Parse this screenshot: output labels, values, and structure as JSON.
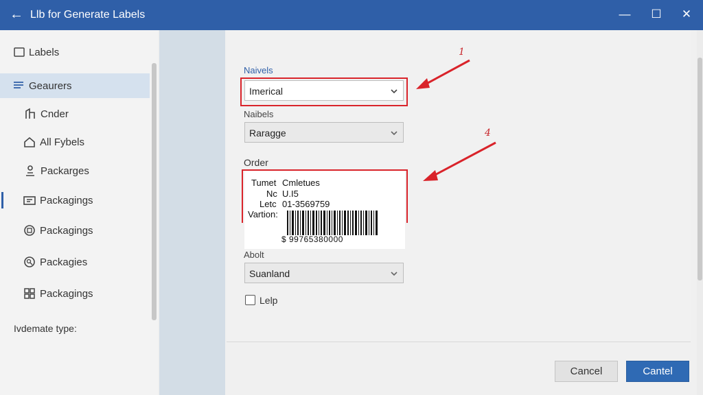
{
  "window": {
    "title": "Llb for Generate Labels",
    "back_icon": "arrow-left-icon",
    "minimize_glyph": "—",
    "maximize_glyph": "☐",
    "close_glyph": "✕"
  },
  "sidebar": {
    "header": "Labels",
    "items": [
      {
        "label": "Geaurers",
        "icon": "list-icon",
        "active": true
      },
      {
        "label": "Cnder",
        "icon": "building-icon"
      },
      {
        "label": "All Fybels",
        "icon": "house-icon"
      },
      {
        "label": "Packarges",
        "icon": "person-icon"
      },
      {
        "label": "Packagings",
        "icon": "folder-icon"
      },
      {
        "label": "Packagings",
        "icon": "package-icon"
      },
      {
        "label": "Packagies",
        "icon": "search-circle-icon"
      },
      {
        "label": "Packagings",
        "icon": "grid-icon"
      }
    ],
    "footer": "Ivdemate type:"
  },
  "form": {
    "field1": {
      "label": "Naivels",
      "value": "Imerical"
    },
    "field2": {
      "label": "Naibels",
      "value": "Raragge"
    },
    "order": {
      "label": "Order"
    },
    "field3": {
      "label": "Abolt",
      "value": "Suanland"
    },
    "checkbox": {
      "label": "Lelp",
      "checked": false
    }
  },
  "preview": {
    "line1_key": "Tumet",
    "line1_val": "Cmletues",
    "line2_key": "Nc",
    "line2_val": "U.I5",
    "line3_key": "Letc",
    "line3_val": "01-3569759",
    "line4_key": "Vartion:",
    "barcode_number": "$ 99765380000"
  },
  "annotations": {
    "callout_1": "1",
    "callout_2": "4",
    "color": "#d9232a"
  },
  "buttons": {
    "cancel": "Cancel",
    "confirm": "Cantel"
  },
  "colors": {
    "titlebar": "#2f5fa8",
    "primary_button": "#2f6ab4",
    "annotation": "#d9232a"
  }
}
